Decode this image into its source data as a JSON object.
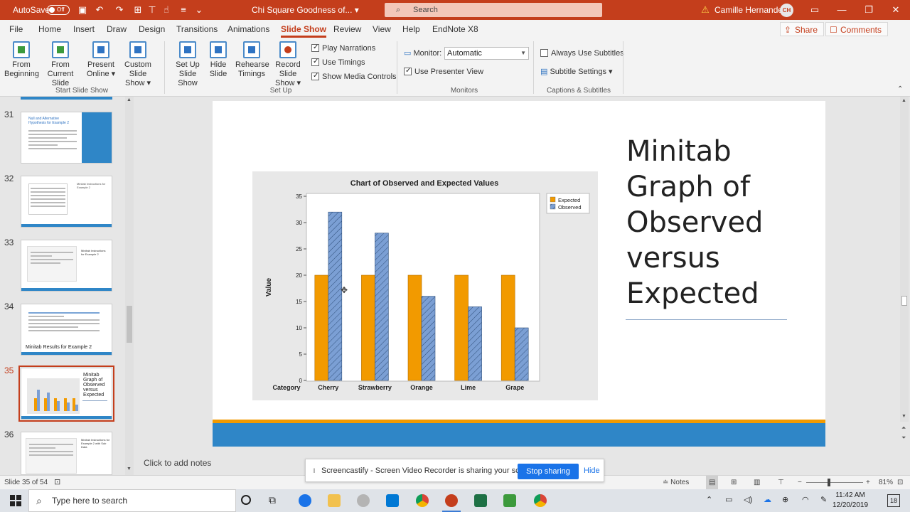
{
  "titlebar": {
    "autosave_label": "AutoSave",
    "autosave_state": "Off",
    "doc_title": "Chi Square Goodness of...",
    "search_placeholder": "Search",
    "user_name": "Camille Hernandez",
    "user_initials": "CH"
  },
  "menu": {
    "tabs": [
      "File",
      "Home",
      "Insert",
      "Draw",
      "Design",
      "Transitions",
      "Animations",
      "Slide Show",
      "Review",
      "View",
      "Help",
      "EndNote X8"
    ],
    "active": "Slide Show",
    "share_label": "Share",
    "comments_label": "Comments"
  },
  "ribbon": {
    "from_beginning": [
      "From",
      "Beginning"
    ],
    "from_current": [
      "From",
      "Current Slide"
    ],
    "present_online": [
      "Present",
      "Online ▾"
    ],
    "custom_show": [
      "Custom Slide",
      "Show ▾"
    ],
    "group_start": "Start Slide Show",
    "setup_show": [
      "Set Up",
      "Slide Show"
    ],
    "hide_slide": [
      "Hide",
      "Slide"
    ],
    "rehearse": [
      "Rehearse",
      "Timings"
    ],
    "record": [
      "Record Slide",
      "Show ▾"
    ],
    "play_narrations": "Play Narrations",
    "use_timings": "Use Timings",
    "show_media": "Show Media Controls",
    "group_setup": "Set Up",
    "monitor_label": "Monitor:",
    "monitor_value": "Automatic",
    "presenter_view": "Use Presenter View",
    "group_monitors": "Monitors",
    "always_subtitles": "Always Use Subtitles",
    "subtitle_settings": "Subtitle Settings ▾",
    "group_captions": "Captions & Subtitles"
  },
  "thumbnails": [
    {
      "num": "31",
      "title": "Null and Alternative Hypothesis for Example 2"
    },
    {
      "num": "32",
      "title": "Minitab Instructions for Example 2"
    },
    {
      "num": "33",
      "title": "Minitab Instructions for Example 2"
    },
    {
      "num": "34",
      "title": "Minitab Results for Example 2"
    },
    {
      "num": "35",
      "title": "Minitab Graph of Observed versus Expected"
    },
    {
      "num": "36",
      "title": "Minitab Instructions for Example 2 with Sub Data"
    }
  ],
  "thumb34_caption": "Minitab Results for Example 2",
  "thumb35_lines": [
    "Minitab",
    "Graph of",
    "Observed",
    "versus",
    "Expected"
  ],
  "slide": {
    "title_lines": [
      "Minitab",
      "Graph of",
      "Observed",
      "versus",
      "Expected"
    ]
  },
  "chart_data": {
    "type": "bar",
    "title": "Chart of Observed and Expected Values",
    "ylabel": "Value",
    "xlabel": "Category",
    "categories": [
      "Cherry",
      "Strawberry",
      "Orange",
      "Lime",
      "Grape"
    ],
    "series": [
      {
        "name": "Expected",
        "values": [
          20,
          20,
          20,
          20,
          20
        ],
        "color": "#f29a00"
      },
      {
        "name": "Observed",
        "values": [
          32,
          28,
          16,
          14,
          10
        ],
        "color": "#7b9fd4"
      }
    ],
    "ylim": [
      0,
      35
    ],
    "yticks": [
      0,
      5,
      10,
      15,
      20,
      25,
      30,
      35
    ],
    "legend": "top-right"
  },
  "notes_placeholder": "Click to add notes",
  "status": {
    "slide_counter": "Slide 35 of 54",
    "notes_label": "Notes",
    "zoom": "81%"
  },
  "share_banner": {
    "message": "Screencastify - Screen Video Recorder is sharing your screen.",
    "stop": "Stop sharing",
    "hide": "Hide"
  },
  "taskbar": {
    "search_placeholder": "Type here to search",
    "time": "11:42 AM",
    "date": "12/20/2019",
    "notification_count": "18"
  }
}
